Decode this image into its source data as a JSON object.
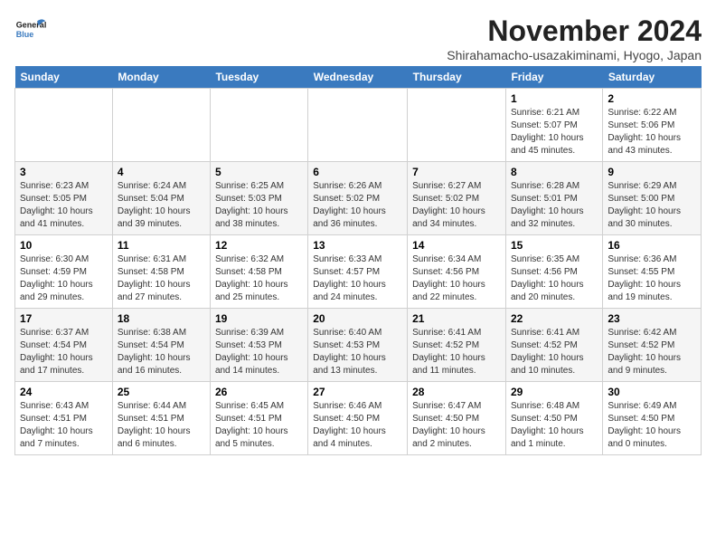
{
  "logo": {
    "line1": "General",
    "line2": "Blue"
  },
  "title": "November 2024",
  "subtitle": "Shirahamacho-usazakiminami, Hyogo, Japan",
  "days_of_week": [
    "Sunday",
    "Monday",
    "Tuesday",
    "Wednesday",
    "Thursday",
    "Friday",
    "Saturday"
  ],
  "weeks": [
    [
      {
        "day": "",
        "info": ""
      },
      {
        "day": "",
        "info": ""
      },
      {
        "day": "",
        "info": ""
      },
      {
        "day": "",
        "info": ""
      },
      {
        "day": "",
        "info": ""
      },
      {
        "day": "1",
        "info": "Sunrise: 6:21 AM\nSunset: 5:07 PM\nDaylight: 10 hours and 45 minutes."
      },
      {
        "day": "2",
        "info": "Sunrise: 6:22 AM\nSunset: 5:06 PM\nDaylight: 10 hours and 43 minutes."
      }
    ],
    [
      {
        "day": "3",
        "info": "Sunrise: 6:23 AM\nSunset: 5:05 PM\nDaylight: 10 hours and 41 minutes."
      },
      {
        "day": "4",
        "info": "Sunrise: 6:24 AM\nSunset: 5:04 PM\nDaylight: 10 hours and 39 minutes."
      },
      {
        "day": "5",
        "info": "Sunrise: 6:25 AM\nSunset: 5:03 PM\nDaylight: 10 hours and 38 minutes."
      },
      {
        "day": "6",
        "info": "Sunrise: 6:26 AM\nSunset: 5:02 PM\nDaylight: 10 hours and 36 minutes."
      },
      {
        "day": "7",
        "info": "Sunrise: 6:27 AM\nSunset: 5:02 PM\nDaylight: 10 hours and 34 minutes."
      },
      {
        "day": "8",
        "info": "Sunrise: 6:28 AM\nSunset: 5:01 PM\nDaylight: 10 hours and 32 minutes."
      },
      {
        "day": "9",
        "info": "Sunrise: 6:29 AM\nSunset: 5:00 PM\nDaylight: 10 hours and 30 minutes."
      }
    ],
    [
      {
        "day": "10",
        "info": "Sunrise: 6:30 AM\nSunset: 4:59 PM\nDaylight: 10 hours and 29 minutes."
      },
      {
        "day": "11",
        "info": "Sunrise: 6:31 AM\nSunset: 4:58 PM\nDaylight: 10 hours and 27 minutes."
      },
      {
        "day": "12",
        "info": "Sunrise: 6:32 AM\nSunset: 4:58 PM\nDaylight: 10 hours and 25 minutes."
      },
      {
        "day": "13",
        "info": "Sunrise: 6:33 AM\nSunset: 4:57 PM\nDaylight: 10 hours and 24 minutes."
      },
      {
        "day": "14",
        "info": "Sunrise: 6:34 AM\nSunset: 4:56 PM\nDaylight: 10 hours and 22 minutes."
      },
      {
        "day": "15",
        "info": "Sunrise: 6:35 AM\nSunset: 4:56 PM\nDaylight: 10 hours and 20 minutes."
      },
      {
        "day": "16",
        "info": "Sunrise: 6:36 AM\nSunset: 4:55 PM\nDaylight: 10 hours and 19 minutes."
      }
    ],
    [
      {
        "day": "17",
        "info": "Sunrise: 6:37 AM\nSunset: 4:54 PM\nDaylight: 10 hours and 17 minutes."
      },
      {
        "day": "18",
        "info": "Sunrise: 6:38 AM\nSunset: 4:54 PM\nDaylight: 10 hours and 16 minutes."
      },
      {
        "day": "19",
        "info": "Sunrise: 6:39 AM\nSunset: 4:53 PM\nDaylight: 10 hours and 14 minutes."
      },
      {
        "day": "20",
        "info": "Sunrise: 6:40 AM\nSunset: 4:53 PM\nDaylight: 10 hours and 13 minutes."
      },
      {
        "day": "21",
        "info": "Sunrise: 6:41 AM\nSunset: 4:52 PM\nDaylight: 10 hours and 11 minutes."
      },
      {
        "day": "22",
        "info": "Sunrise: 6:41 AM\nSunset: 4:52 PM\nDaylight: 10 hours and 10 minutes."
      },
      {
        "day": "23",
        "info": "Sunrise: 6:42 AM\nSunset: 4:52 PM\nDaylight: 10 hours and 9 minutes."
      }
    ],
    [
      {
        "day": "24",
        "info": "Sunrise: 6:43 AM\nSunset: 4:51 PM\nDaylight: 10 hours and 7 minutes."
      },
      {
        "day": "25",
        "info": "Sunrise: 6:44 AM\nSunset: 4:51 PM\nDaylight: 10 hours and 6 minutes."
      },
      {
        "day": "26",
        "info": "Sunrise: 6:45 AM\nSunset: 4:51 PM\nDaylight: 10 hours and 5 minutes."
      },
      {
        "day": "27",
        "info": "Sunrise: 6:46 AM\nSunset: 4:50 PM\nDaylight: 10 hours and 4 minutes."
      },
      {
        "day": "28",
        "info": "Sunrise: 6:47 AM\nSunset: 4:50 PM\nDaylight: 10 hours and 2 minutes."
      },
      {
        "day": "29",
        "info": "Sunrise: 6:48 AM\nSunset: 4:50 PM\nDaylight: 10 hours and 1 minute."
      },
      {
        "day": "30",
        "info": "Sunrise: 6:49 AM\nSunset: 4:50 PM\nDaylight: 10 hours and 0 minutes."
      }
    ]
  ]
}
